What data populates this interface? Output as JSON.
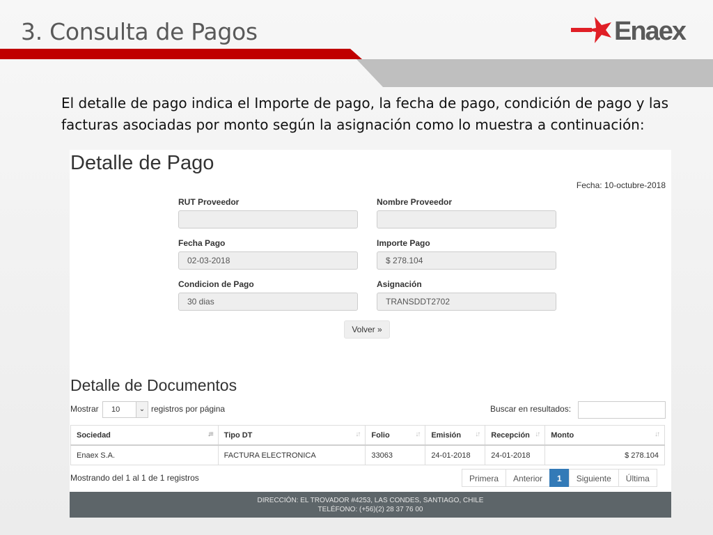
{
  "slide": {
    "title": "3. Consulta de Pagos",
    "logo_text": "Enaex",
    "intro": "El detalle de pago indica el Importe de pago, la fecha de pago, condición de pago y las facturas asociadas por monto según la asignación como lo muestra a continuación:"
  },
  "detalle_pago": {
    "heading": "Detalle de Pago",
    "fecha": "Fecha: 10-octubre-2018",
    "fields": {
      "rut_label": "RUT Proveedor",
      "rut_value": "",
      "nombre_label": "Nombre Proveedor",
      "nombre_value": "",
      "fecha_label": "Fecha Pago",
      "fecha_value": "02-03-2018",
      "importe_label": "Importe Pago",
      "importe_value": "$ 278.104",
      "condicion_label": "Condicion de Pago",
      "condicion_value": "30 dias",
      "asignacion_label": "Asignación",
      "asignacion_value": "TRANSDDT2702"
    },
    "volver_label": "Volver »"
  },
  "documentos": {
    "heading": "Detalle de Documentos",
    "mostrar_label": "Mostrar",
    "page_size": "10",
    "registros_label": "registros por página",
    "buscar_label": "Buscar en resultados:",
    "columns": [
      "Sociedad",
      "Tipo DT",
      "Folio",
      "Emisión",
      "Recepción",
      "Monto"
    ],
    "rows": [
      [
        "Enaex S.A.",
        "FACTURA ELECTRONICA",
        "33063",
        "24-01-2018",
        "24-01-2018",
        "$ 278.104"
      ]
    ],
    "summary": "Mostrando del 1 al 1 de 1 registros",
    "pager": {
      "first": "Primera",
      "prev": "Anterior",
      "current": "1",
      "next": "Siguiente",
      "last": "Última"
    }
  },
  "footer": {
    "address": "DIRECCIÓN: EL TROVADOR #4253, LAS CONDES, SANTIAGO, CHILE",
    "phone": "TELÉFONO: (+56)(2) 28 37 76 00"
  },
  "colors": {
    "brand_red": "#c00000",
    "logo_red": "#e01f26",
    "logo_gray": "#5a5a5a",
    "pager_active": "#337ab7"
  }
}
